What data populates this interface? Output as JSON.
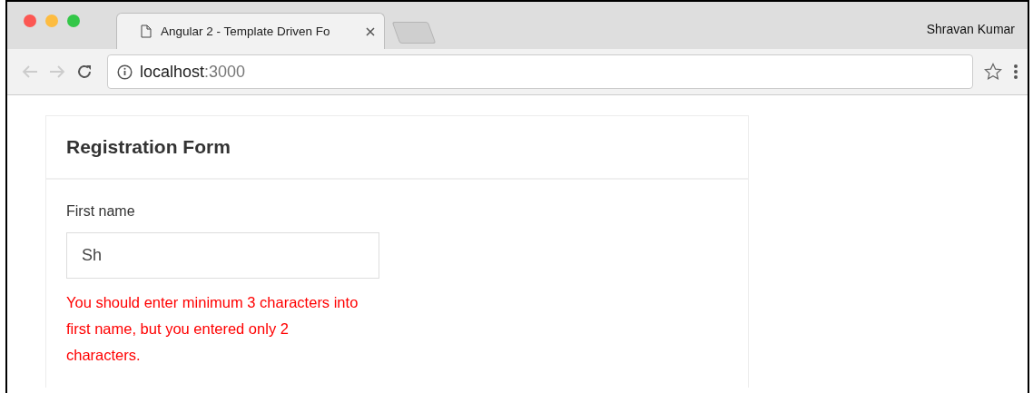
{
  "browser": {
    "tab": {
      "title": "Angular 2 - Template Driven Fo",
      "selected": true
    },
    "profile": "Shravan Kumar",
    "url": {
      "host": "localhost",
      "port": ":3000"
    }
  },
  "form": {
    "title": "Registration Form",
    "fields": [
      {
        "label": "First name",
        "value": "Sh",
        "error": "You should enter minimum 3 characters into first name, but you entered only 2 characters."
      }
    ]
  }
}
